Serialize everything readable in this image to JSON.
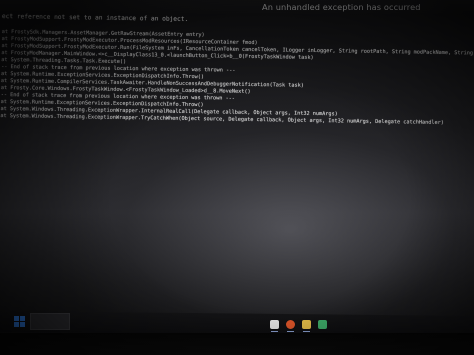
{
  "window": {
    "title": "An unhandled exception has occurred"
  },
  "console": {
    "lines": [
      "ect reference not set to an instance of an object.",
      "at FrostySdk.Managers.AssetManager.GetRawStream(AssetEntry entry)",
      "at FrostyModSupport.FrostyModExecutor.ProcessModResources(IResourceContainer fmod)",
      "at FrostyModSupport.FrostyModExecutor.Run(FileSystem inFs, CancellationToken cancelToken, ILogger inLogger, String rootPath, String modPackName, String[] ",
      "at FrostyModManager.MainWindow.<>c__DisplayClass13_0.<launchButton_Click>b__0(FrostyTaskWindow task)",
      "at System.Threading.Tasks.Task.Execute()",
      "-- End of stack trace from previous location where exception was thrown ---",
      "at System.Runtime.ExceptionServices.ExceptionDispatchInfo.Throw()",
      "at System.Runtime.CompilerServices.TaskAwaiter.HandleNonSuccessAndDebuggerNotification(Task task)",
      "at Frosty.Core.Windows.FrostyTaskWindow.<FrostyTaskWindow_Loaded>d__8.MoveNext()",
      "-- End of stack trace from previous location where exception was thrown ---",
      "at System.Runtime.ExceptionServices.ExceptionDispatchInfo.Throw()",
      "at System.Windows.Threading.ExceptionWrapper.InternalRealCall(Delegate callback, Object args, Int32 numArgs)",
      "at System.Windows.Threading.ExceptionWrapper.TryCatchWhen(Object source, Delegate callback, Object args, Int32 numArgs, Delegate catchHandler)"
    ]
  },
  "taskbar": {
    "start_icon": "windows-logo-icon",
    "search_icon": "search-box",
    "tray_icons": [
      {
        "name": "app-icon",
        "color": "#e8e8e8"
      },
      {
        "name": "brave-icon",
        "color": "#e0562a"
      },
      {
        "name": "folder-icon",
        "color": "#e8c04a"
      },
      {
        "name": "app-icon-green",
        "color": "#3fae6a"
      }
    ]
  }
}
